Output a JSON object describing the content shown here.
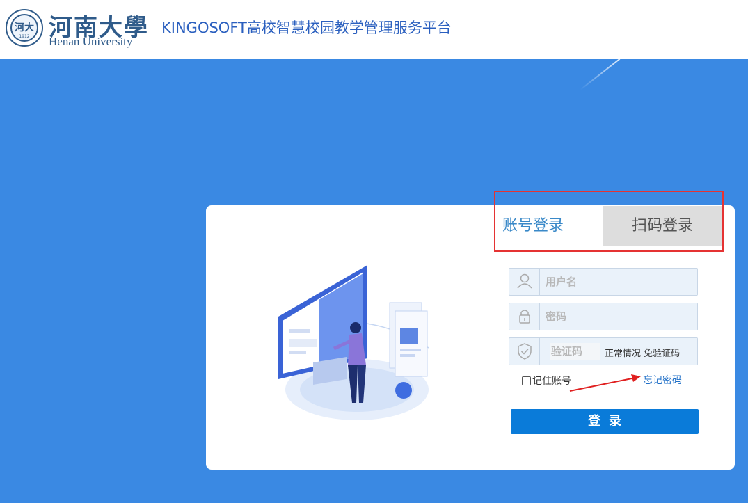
{
  "header": {
    "logo_year": "1912",
    "university_cn": "河南大學",
    "university_en": "Henan University",
    "platform_title": "KINGOSOFT高校智慧校园教学管理服务平台"
  },
  "tabs": {
    "account": "账号登录",
    "qr": "扫码登录"
  },
  "form": {
    "username_placeholder": "用户名",
    "password_placeholder": "密码",
    "captcha_placeholder": "验证码",
    "captcha_note": "正常情况 免验证码",
    "remember_label": "记住账号",
    "forgot_label": "忘记密码",
    "login_label": "登录"
  },
  "colors": {
    "background": "#3a89e3",
    "accent": "#0a7bd9",
    "highlight": "#e53333"
  }
}
